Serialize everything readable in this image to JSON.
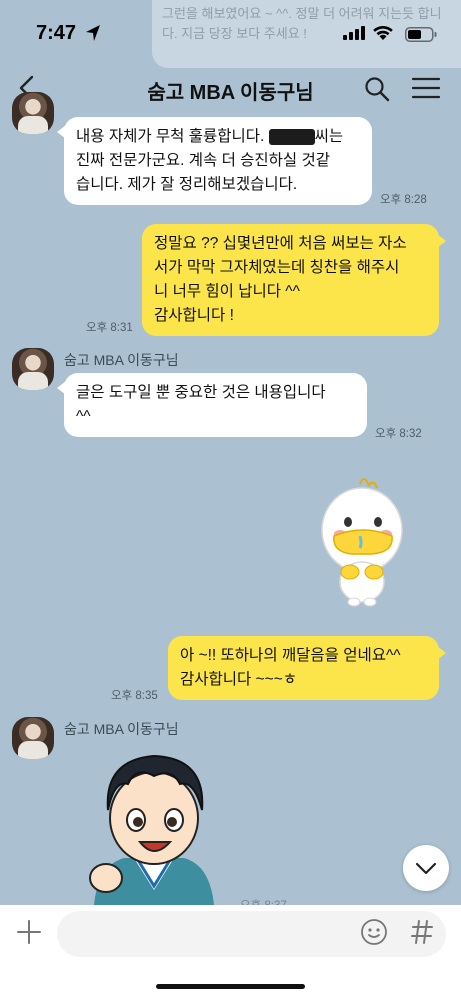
{
  "status_bar": {
    "time": "7:47",
    "background_notice": "그런을 해보였어요 ~ ^^. 정말 더 어려워 지는듯 합니다. 지금 당장 보다 \n 주세요 !"
  },
  "header": {
    "title": "숨고 MBA 이동구님",
    "back_icon": "chevron-left-icon",
    "search_icon": "search-icon",
    "menu_icon": "hamburger-menu-icon"
  },
  "messages": [
    {
      "side": "in",
      "text_before_redaction": "내용 자체가 무척 훌륭합니다. ",
      "text_after_redaction": "씨는\n진짜 전문가군요. 계속 더 승진하실 것같\n습니다.  제가 잘 정리해보겠습니다.",
      "time": "오후 8:28"
    },
    {
      "side": "out",
      "text": "정말요 ?? 십몇년만에 처음 써보는 자소\n서가 막막 그자체였는데 칭찬을 해주시\n니 너무 힘이 납니다 ^^\n감사합니다 !",
      "time": "오후 8:31"
    },
    {
      "side": "in",
      "sender": "숨고 MBA 이동구님",
      "text": "글은 도구일 뿐 중요한 것은 내용입니다\n^^",
      "time": "오후 8:32"
    },
    {
      "side": "out",
      "type": "sticker",
      "sticker": "yellow-duck-character-sticker"
    },
    {
      "side": "out",
      "text": "아 ~!! 또하나의 깨달음을 얻네요^^\n감사합니다 ~~~ㅎ",
      "time": "오후 8:35"
    },
    {
      "side": "in",
      "sender": "숨고 MBA 이동구님",
      "type": "sticker",
      "sticker": "anime-boy-thumbs-up-sticker"
    }
  ],
  "input_bar": {
    "placeholder": "",
    "plus_icon": "plus-icon",
    "emoji_icon": "emoji-icon",
    "hash_icon": "hash-icon"
  },
  "colors": {
    "chat_background": "#abc1d1",
    "my_bubble": "#fbe54a",
    "their_bubble": "#ffffff"
  }
}
